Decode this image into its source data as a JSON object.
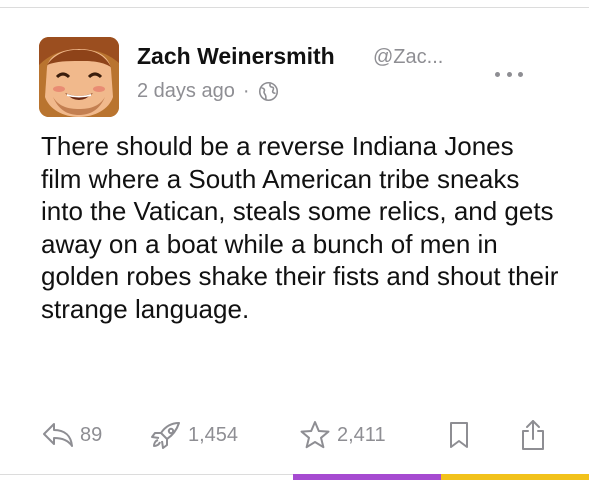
{
  "post": {
    "author_name": "Zach Weinersmith",
    "author_handle": "@Zac...",
    "time": "2 days ago",
    "separator": "·",
    "visibility_icon": "globe-icon",
    "more_icon": "more-dots-icon",
    "text": "There should be a reverse Indiana Jones film where a South American tribe sneaks into the Vatican, steals some relics, and gets away on a boat while a bunch of men in golden robes shake their fists and shout their strange language."
  },
  "actions": {
    "reply": {
      "icon": "reply-icon",
      "count": "89"
    },
    "boost": {
      "icon": "rocket-icon",
      "count": "1,454"
    },
    "favorite": {
      "icon": "star-icon",
      "count": "2,411"
    },
    "bookmark": {
      "icon": "bookmark-icon"
    },
    "share": {
      "icon": "share-icon"
    }
  },
  "colors": {
    "muted": "#8e8e93",
    "text": "#111111",
    "accent_purple": "#a64bd1",
    "accent_yellow": "#f2c21b",
    "avatar_bg": "#b9742f"
  }
}
